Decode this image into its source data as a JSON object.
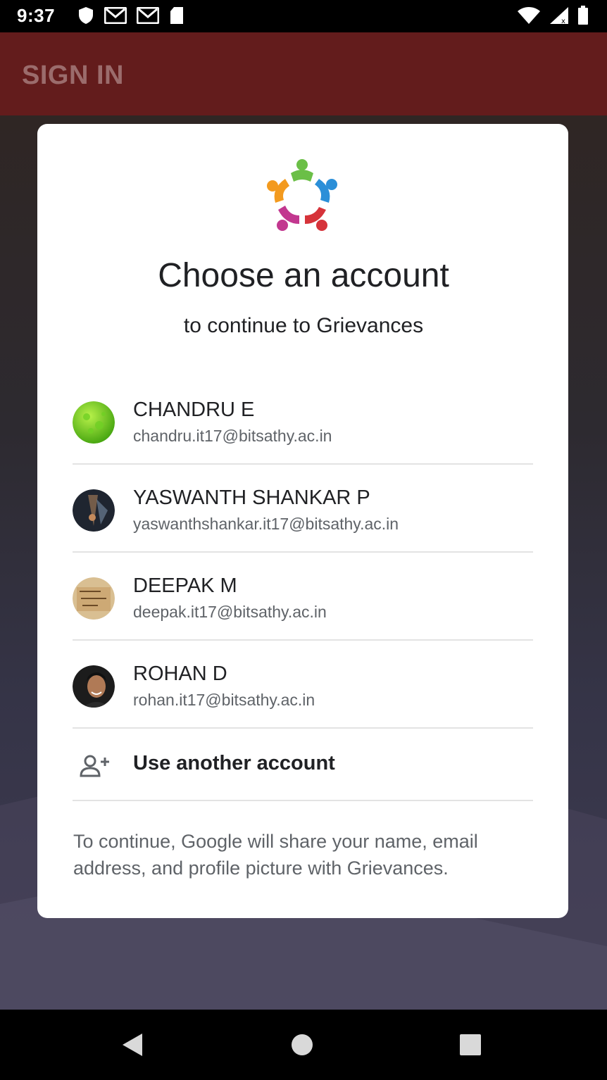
{
  "status_bar": {
    "time": "9:37",
    "icons_left": [
      "shield-icon",
      "gmail-icon",
      "gmail-icon",
      "sd-card-icon"
    ],
    "icons_right": [
      "wifi-icon",
      "signal-icon",
      "battery-icon"
    ]
  },
  "app_bar": {
    "title": "SIGN IN",
    "color": "#631c1c"
  },
  "dialog": {
    "title": "Choose an account",
    "subtitle": "to continue to Grievances",
    "accounts": [
      {
        "name": "CHANDRU E",
        "email": "chandru.it17@bitsathy.ac.in"
      },
      {
        "name": "YASWANTH SHANKAR P",
        "email": "yaswanthshankar.it17@bitsathy.ac.in"
      },
      {
        "name": "DEEPAK M",
        "email": "deepak.it17@bitsathy.ac.in"
      },
      {
        "name": "ROHAN D",
        "email": "rohan.it17@bitsathy.ac.in"
      }
    ],
    "another_account_label": "Use another account",
    "disclaimer": "To continue, Google will share your name, email address, and profile picture with Grievances."
  },
  "nav_bar": {
    "icons": [
      "back-icon",
      "home-icon",
      "recents-icon"
    ]
  }
}
